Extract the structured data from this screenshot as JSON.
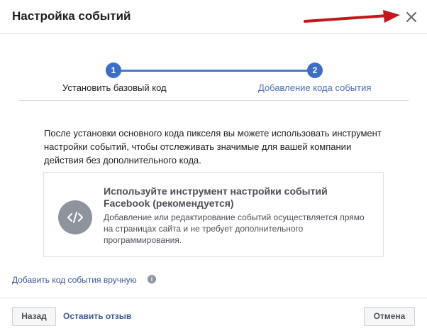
{
  "dialog": {
    "title": "Настройка событий"
  },
  "stepper": {
    "steps": [
      {
        "number": "1",
        "label": "Установить базовый код"
      },
      {
        "number": "2",
        "label": "Добавление кода события"
      }
    ]
  },
  "description": "После установки основного кода пикселя вы можете использовать инструмент настройки событий, чтобы отслеживать значимые для вашей компании действия без дополнительного кода.",
  "option_card": {
    "icon": "code-icon",
    "title": "Используйте инструмент настройки событий Facebook (рекомендуется)",
    "description": "Добавление или редактирование событий осуществляется прямо на страницах сайта и не требует дополнительного программирования."
  },
  "manual_link": {
    "label": "Добавить код события вручную",
    "info_glyph": "i"
  },
  "footer": {
    "back_label": "Назад",
    "feedback_label": "Оставить отзыв",
    "cancel_label": "Отмена"
  },
  "colors": {
    "accent": "#3b6ec6",
    "link": "#385898",
    "annotation_arrow": "#c4161c"
  }
}
